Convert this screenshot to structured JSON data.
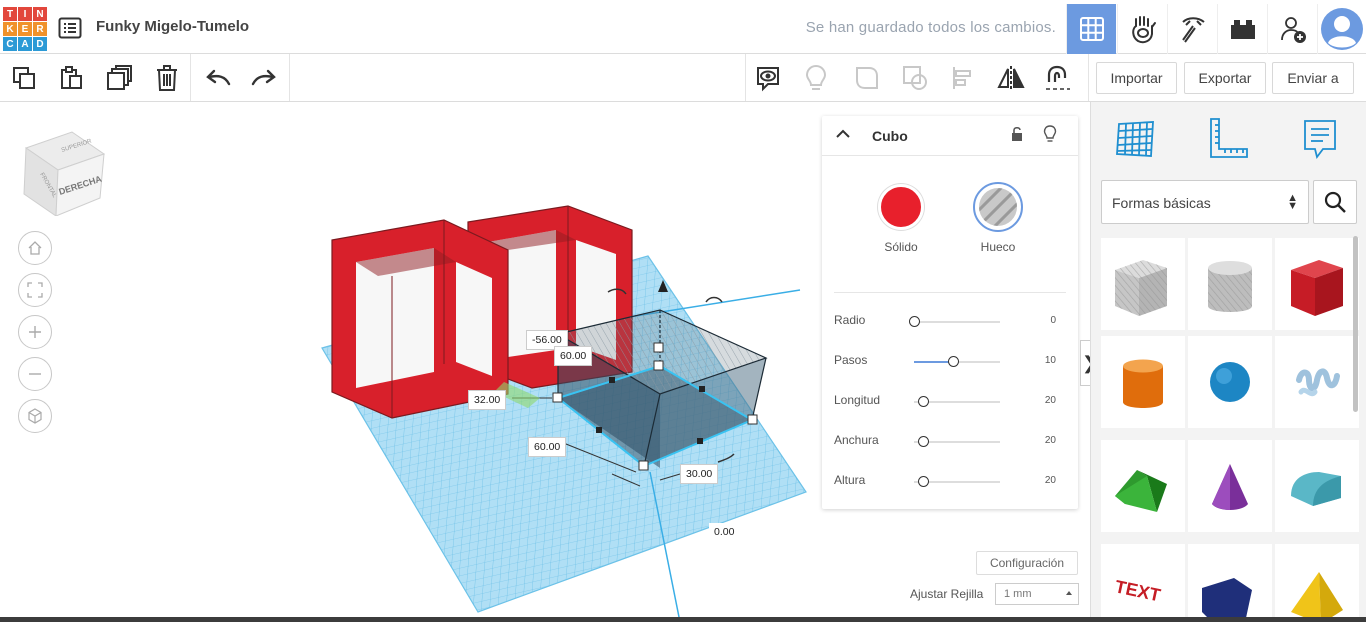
{
  "app": {
    "logo_letters": [
      "T",
      "I",
      "N",
      "K",
      "E",
      "R",
      "C",
      "A",
      "D"
    ],
    "logo_colors": [
      "#e2473c",
      "#e2473c",
      "#e2473c",
      "#f0922b",
      "#f0922b",
      "#f0922b",
      "#2c9ad6",
      "#2c9ad6",
      "#2c9ad6"
    ],
    "design_title": "Funky Migelo-Tumelo",
    "save_status": "Se han guardado todos los cambios."
  },
  "toolbar": {
    "import_label": "Importar",
    "export_label": "Exportar",
    "send_label": "Enviar a"
  },
  "viewcube": {
    "face_right": "DERECHA",
    "face_front": "FRONTAL",
    "face_top": "SUPERIOR"
  },
  "workplane": {
    "dim_x": "-56.00",
    "dim_length": "60.00",
    "dim_left": "32.00",
    "dim_width": "60.00",
    "dim_height": "30.00",
    "dim_elev": "0.00"
  },
  "inspector": {
    "title": "Cubo",
    "solid_label": "Sólido",
    "hole_label": "Hueco",
    "solid_color": "#e8202c",
    "properties": [
      {
        "label": "Radio",
        "value": "0",
        "level": 0.0
      },
      {
        "label": "Pasos",
        "value": "10",
        "level": 0.45
      },
      {
        "label": "Longitud",
        "value": "20",
        "level": 0.1
      },
      {
        "label": "Anchura",
        "value": "20",
        "level": 0.1
      },
      {
        "label": "Altura",
        "value": "20",
        "level": 0.1
      }
    ]
  },
  "settings": {
    "config_label": "Configuración",
    "snap_label": "Ajustar Rejilla",
    "snap_value": "1 mm"
  },
  "sidebar": {
    "category": "Formas básicas"
  },
  "colors": {
    "accent": "#6c9ae0",
    "grid_blue": "#7ecbee",
    "shape_red": "#d8202b"
  }
}
